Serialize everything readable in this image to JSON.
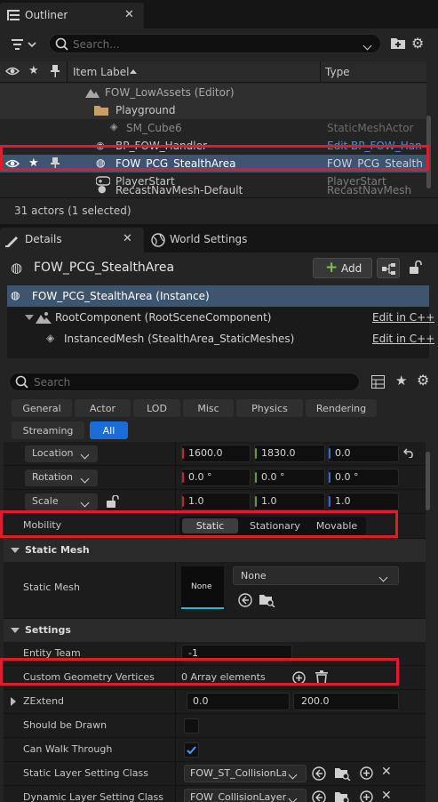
{
  "outliner": {
    "tab_title": "Outliner",
    "search_placeholder": "Search...",
    "col_item_label": "Item Label",
    "col_type": "Type",
    "rows": [
      {
        "label": "FOW_LowAssets (Editor)",
        "type": ""
      },
      {
        "label": "Playground",
        "type": ""
      },
      {
        "label": "SM_Cube6",
        "type": "StaticMeshActor"
      },
      {
        "label": "BP_FOW_Handler",
        "type": "Edit BP_FOW_Hand"
      },
      {
        "label": "FOW_PCG_StealthArea",
        "type": "FOW_PCG_StealthA"
      },
      {
        "label": "PlayerStart",
        "type": "PlayerStart"
      },
      {
        "label": "RecastNavMesh-Default",
        "type": "RecastNavMesh"
      }
    ],
    "status": "31 actors (1 selected)"
  },
  "details": {
    "tab_details": "Details",
    "tab_world_settings": "World Settings",
    "actor_name": "FOW_PCG_StealthArea",
    "add_label": "Add",
    "components": [
      {
        "label": "FOW_PCG_StealthArea (Instance)",
        "edit": ""
      },
      {
        "label": "RootComponent (RootSceneComponent)",
        "edit": "Edit in C++"
      },
      {
        "label": "InstancedMesh (StealthArea_StaticMeshes)",
        "edit": "Edit in C++"
      }
    ],
    "search_placeholder": "Search",
    "filters": [
      "General",
      "Actor",
      "LOD",
      "Misc",
      "Physics",
      "Rendering",
      "Streaming",
      "All"
    ],
    "transform": {
      "location_label": "Location",
      "rotation_label": "Rotation",
      "scale_label": "Scale",
      "location": [
        "1600.0",
        "1830.0",
        "0.0"
      ],
      "rotation": [
        "0.0 °",
        "0.0 °",
        "0.0 °"
      ],
      "scale": [
        "1.0",
        "1.0",
        "1.0"
      ]
    },
    "mobility": {
      "label": "Mobility",
      "options": [
        "Static",
        "Stationary",
        "Movable"
      ],
      "selected": "Static"
    },
    "static_mesh_section": {
      "title": "Static Mesh",
      "prop_label": "Static Mesh",
      "thumb_text": "None",
      "value": "None"
    },
    "settings_section": {
      "title": "Settings",
      "entity_team_label": "Entity Team",
      "entity_team_value": "-1",
      "custom_geo_label": "Custom Geometry Vertices",
      "custom_geo_value": "0 Array elements",
      "zextend_label": "ZExtend",
      "zextend_values": [
        "0.0",
        "200.0"
      ],
      "should_be_drawn_label": "Should be Drawn",
      "should_be_drawn": false,
      "can_walk_through_label": "Can Walk Through",
      "can_walk_through": true,
      "static_layer_label": "Static Layer Setting Class",
      "static_layer_value": "FOW_ST_CollisionLay",
      "dynamic_layer_label": "Dynamic Layer Setting Class",
      "dynamic_layer_value": "FOW_CollisionLayer"
    }
  },
  "colors": {
    "highlight": "#e01b2a",
    "accent_blue": "#1a6cd6",
    "selected_row": "#3e5570",
    "axis_x": "#c4232b",
    "axis_y": "#5e9d26",
    "axis_z": "#2f6bd1",
    "add_green": "#7cc242"
  }
}
